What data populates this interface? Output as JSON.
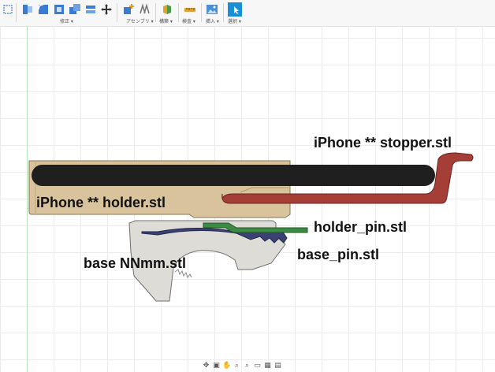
{
  "toolbar": {
    "groups": [
      {
        "label": "修正 ▾"
      },
      {
        "label": "アセンブリ ▾"
      },
      {
        "label": "構築 ▾"
      },
      {
        "label": "検査 ▾"
      },
      {
        "label": "挿入 ▾"
      },
      {
        "label": "選択 ▾"
      }
    ],
    "accent": "#1a8fd6"
  },
  "viewport": {
    "labels": {
      "stopper": "iPhone ** stopper.stl",
      "holder": "iPhone ** holder.stl",
      "holder_pin": "holder_pin.stl",
      "base_pin": "base_pin.stl",
      "base": "base NNmm.stl"
    },
    "colors": {
      "holder": "#d8c39d",
      "stopper": "#a53e37",
      "phone": "#1f1f1f",
      "holder_pin": "#3d8a44",
      "base_pin": "#3b4173",
      "base": "#dddcd6"
    }
  },
  "navbar": {
    "icons": [
      "orbit-icon",
      "look-at-icon",
      "pan-icon",
      "zoom-icon",
      "zoom-window-icon",
      "display-settings-icon",
      "grid-settings-icon",
      "viewports-icon"
    ]
  }
}
